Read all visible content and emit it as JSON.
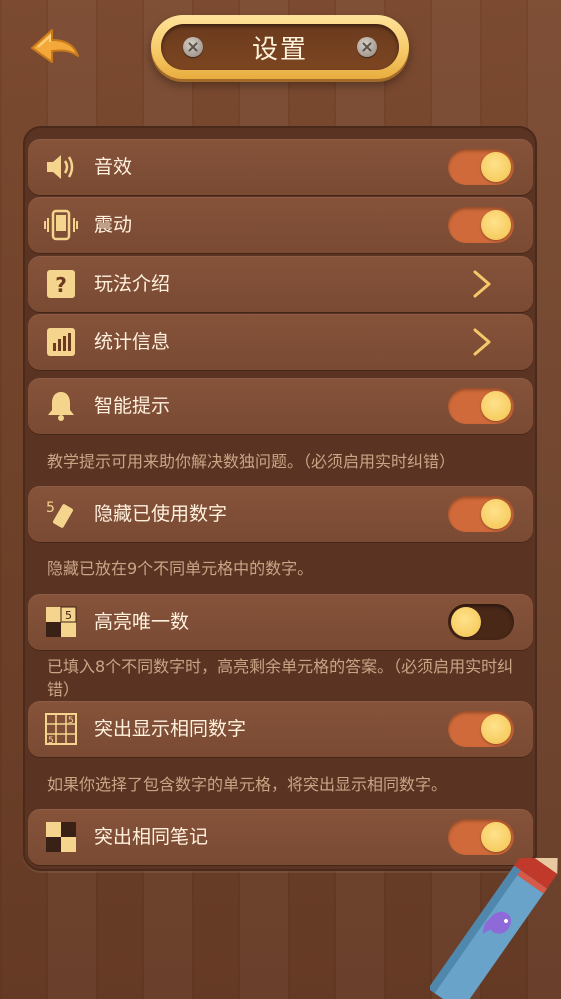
{
  "header": {
    "title": "设置",
    "back_icon": "back-arrow-icon"
  },
  "colors": {
    "accent": "#d06a3a",
    "knob": "#f2c34e",
    "text": "#fff1de",
    "desc": "#c9a586"
  },
  "settings": [
    {
      "label": "音效",
      "icon": "speaker-icon",
      "control": "toggle",
      "value": true
    },
    {
      "label": "震动",
      "icon": "vibration-icon",
      "control": "toggle",
      "value": true
    },
    {
      "label": "玩法介绍",
      "icon": "question-icon",
      "control": "chevron"
    },
    {
      "label": "统计信息",
      "icon": "statistics-icon",
      "control": "chevron"
    },
    {
      "label": "智能提示",
      "icon": "bell-icon",
      "control": "toggle",
      "value": true,
      "description": "教学提示可用来助你解决数独问题。（必须启用实时纠错）"
    },
    {
      "label": "隐藏已使用数字",
      "icon": "eraser-number-icon",
      "control": "toggle",
      "value": true,
      "description": "隐藏已放在9个不同单元格中的数字。"
    },
    {
      "label": "高亮唯一数",
      "icon": "highlight-cell-icon",
      "control": "toggle",
      "value": false,
      "description": "已填入8个不同数字时，高亮剩余单元格的答案。（必须启用实时纠错）"
    },
    {
      "label": "突出显示相同数字",
      "icon": "same-number-grid-icon",
      "control": "toggle",
      "value": true,
      "description": "如果你选择了包含数字的单元格，将突出显示相同数字。"
    },
    {
      "label": "突出相同笔记",
      "icon": "notes-grid-icon",
      "control": "toggle",
      "value": true
    }
  ],
  "icon_digit": "5"
}
